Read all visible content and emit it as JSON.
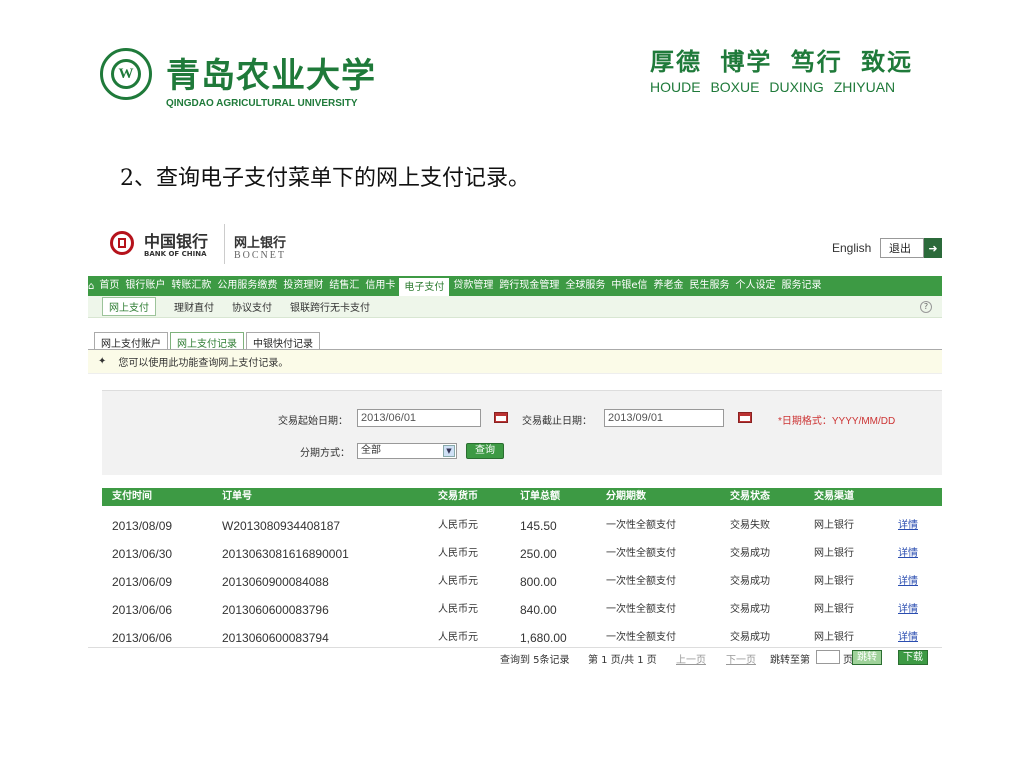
{
  "slide": {
    "university_name_cn": "青岛农业大学",
    "university_name_en": "QINGDAO AGRICULTURAL UNIVERSITY",
    "motto_cn": "厚德 博学 笃行 致远",
    "motto_en": "HOUDE BOXUE DUXING ZHIYUAN",
    "step_title": "2、查询电子支付菜单下的网上支付记录。",
    "brand_color": "#1f7a3a"
  },
  "bank": {
    "name_cn": "中国银行",
    "name_en": "BANK OF CHINA",
    "product_cn": "网上银行",
    "product_en": "BOCNET",
    "language_link": "English",
    "logout_label": "退出",
    "accent_color": "#3d9a44"
  },
  "main_nav": [
    "首页",
    "银行账户",
    "转账汇款",
    "公用服务缴费",
    "投资理财",
    "结售汇",
    "信用卡",
    "电子支付",
    "贷款管理",
    "跨行现金管理",
    "全球服务",
    "中银e信",
    "养老金",
    "民生服务",
    "个人设定",
    "服务记录"
  ],
  "main_nav_active": "电子支付",
  "sub_nav": [
    "网上支付",
    "理财直付",
    "协议支付",
    "银联跨行无卡支付"
  ],
  "tabs": [
    "网上支付账户",
    "网上支付记录",
    "中银快付记录"
  ],
  "notice": "您可以使用此功能查询网上支付记录。",
  "query": {
    "start_label": "交易起始日期：",
    "start_value": "2013/06/01",
    "end_label": "交易截止日期：",
    "end_value": "2013/09/01",
    "date_hint": "*日期格式：YYYY/MM/DD",
    "installment_label": "分期方式：",
    "installment_value": "全部",
    "query_button": "查询"
  },
  "table": {
    "columns": [
      "支付时间",
      "订单号",
      "交易货币",
      "订单总额",
      "分期期数",
      "交易状态",
      "交易渠道"
    ],
    "rows": [
      [
        "2013/08/09",
        "W2013080934408187",
        "人民币元",
        "145.50",
        "一次性全额支付",
        "交易失败",
        "网上银行",
        "详情"
      ],
      [
        "2013/06/30",
        "2013063081616890001",
        "人民币元",
        "250.00",
        "一次性全额支付",
        "交易成功",
        "网上银行",
        "详情"
      ],
      [
        "2013/06/09",
        "2013060900084088",
        "人民币元",
        "800.00",
        "一次性全额支付",
        "交易成功",
        "网上银行",
        "详情"
      ],
      [
        "2013/06/06",
        "2013060600083796",
        "人民币元",
        "840.00",
        "一次性全额支付",
        "交易成功",
        "网上银行",
        "详情"
      ],
      [
        "2013/06/06",
        "2013060600083794",
        "人民币元",
        "1,680.00",
        "一次性全额支付",
        "交易成功",
        "网上银行",
        "详情"
      ]
    ]
  },
  "pager": {
    "summary": "查询到 5条记录",
    "page_info": "第 1 页/共 1 页",
    "prev": "上一页",
    "next": "下一页",
    "jump_label": "跳转至第",
    "page_unit": "页",
    "jump_button": "跳转",
    "download_button": "下载"
  }
}
